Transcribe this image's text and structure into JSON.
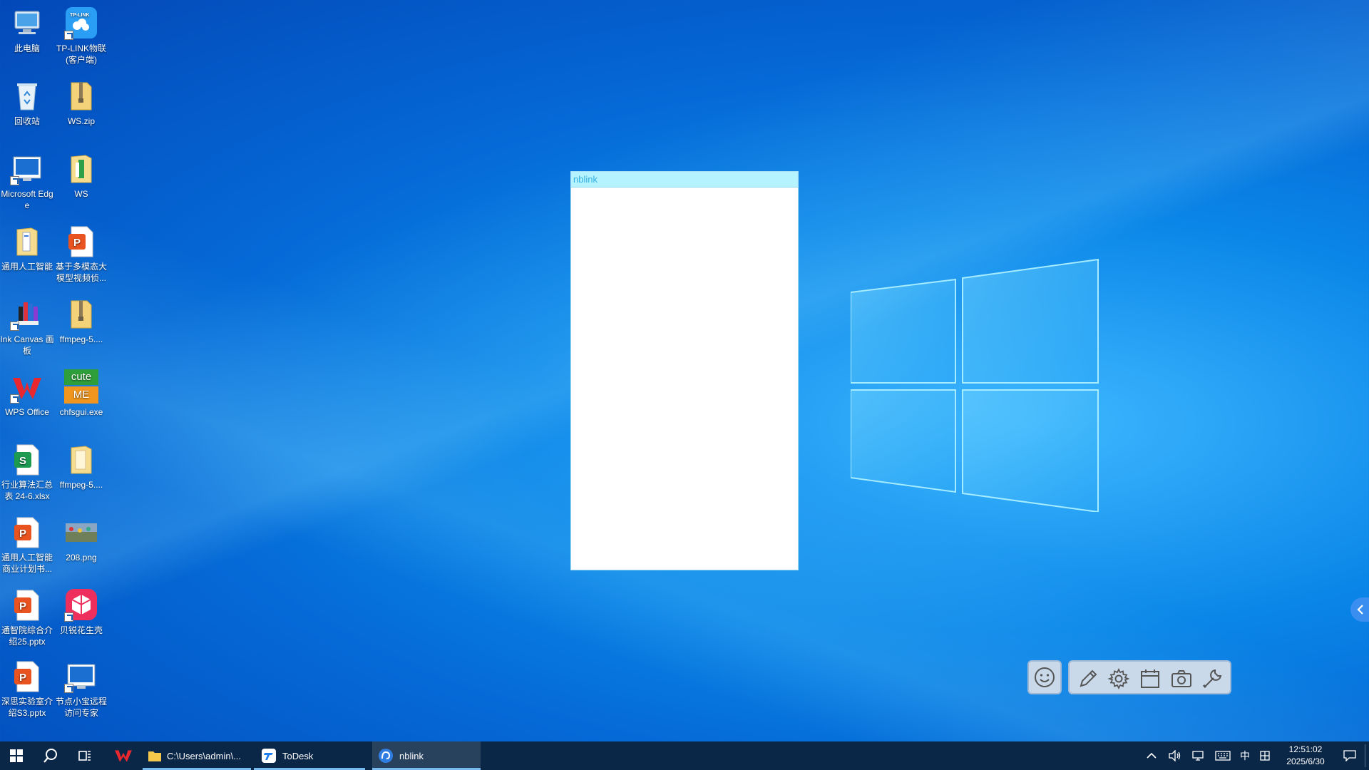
{
  "desktop": {
    "icons": [
      {
        "label": "此电脑",
        "icon": "computer-icon"
      },
      {
        "label": "TP-LINK物联(客户端)",
        "icon": "tplink-icon"
      },
      {
        "label": "回收站",
        "icon": "recycle-bin-icon"
      },
      {
        "label": "WS.zip",
        "icon": "zip-folder-icon"
      },
      {
        "label": "Microsoft Edge",
        "icon": "edge-icon"
      },
      {
        "label": "WS",
        "icon": "folder-icon"
      },
      {
        "label": "通用人工智能",
        "icon": "folder-icon"
      },
      {
        "label": "基于多模态大模型视频侦...",
        "icon": "ppt-file-icon"
      },
      {
        "label": "Ink Canvas 画板",
        "icon": "ink-canvas-icon"
      },
      {
        "label": "ffmpeg-5....",
        "icon": "zip-folder-icon"
      },
      {
        "label": "WPS Office",
        "icon": "wps-icon"
      },
      {
        "label": "chfsgui.exe",
        "icon": "cuteme-icon"
      },
      {
        "label": "行业算法汇总表 24-6.xlsx",
        "icon": "xlsx-file-icon"
      },
      {
        "label": "ffmpeg-5....",
        "icon": "folder-icon"
      },
      {
        "label": "通用人工智能商业计划书...",
        "icon": "ppt-file-icon"
      },
      {
        "label": "208.png",
        "icon": "image-file-icon"
      },
      {
        "label": "通智院综合介绍25.pptx",
        "icon": "ppt-file-icon"
      },
      {
        "label": "贝锐花生壳",
        "icon": "oray-icon"
      },
      {
        "label": "深思实验室介绍S3.pptx",
        "icon": "ppt-file-icon"
      },
      {
        "label": "节点小宝远程访问专家",
        "icon": "remote-access-icon"
      }
    ],
    "cuteme": {
      "top": "cute",
      "bottom": "ME"
    },
    "tplink_badge": "TP-LINK"
  },
  "window": {
    "title": "nblink"
  },
  "float_toolbar": {
    "buttons": [
      "emoji-icon",
      "pen-icon",
      "gear-icon",
      "calendar-icon",
      "camera-icon",
      "wrench-icon"
    ]
  },
  "taskbar": {
    "apps": [
      {
        "label": "C:\\Users\\admin\\...",
        "icon": "file-explorer-icon",
        "active": false
      },
      {
        "label": "ToDesk",
        "icon": "todesk-icon",
        "active": false
      },
      {
        "label": "nblink",
        "icon": "nblink-icon",
        "active": true
      }
    ],
    "tray": {
      "ime": "中",
      "time": "12:51:02",
      "date": "2025/6/30"
    }
  },
  "colors": {
    "taskbar": "#0b2747",
    "titlebar": "#b4f3ff",
    "title_text": "#34aee2",
    "accent": "#76b9ed"
  }
}
